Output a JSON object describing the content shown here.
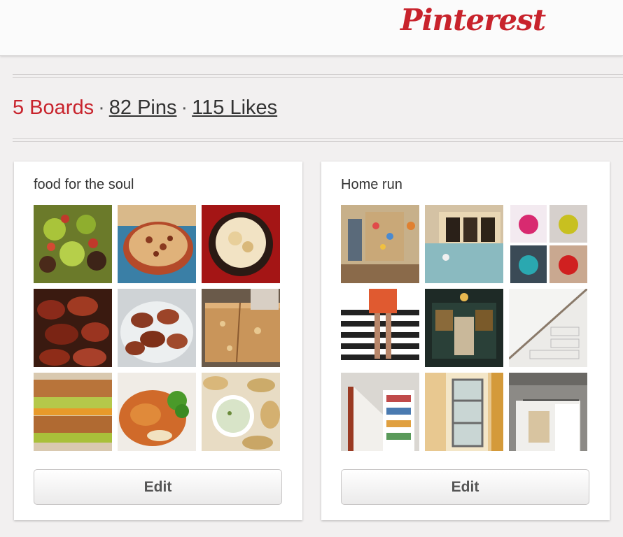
{
  "app": {
    "logo_text": "Pinterest",
    "brand_color": "#c8232c"
  },
  "profile_stats": {
    "boards": "5 Boards",
    "pins": "82 Pins",
    "likes": "115 Likes",
    "separator": "·"
  },
  "boards": [
    {
      "title": "food for the soul",
      "edit_label": "Edit",
      "thumbnails": [
        "avocado-salad",
        "pasta-pot",
        "baked-soup-bowl",
        "bacon-wrapped-bites",
        "bacon-wrapped-bites-plate",
        "crumb-bars",
        "grilled-cheese-avocado",
        "chicken-salad",
        "dumplings-with-dip"
      ]
    },
    {
      "title": "Home run",
      "edit_label": "Edit",
      "thumbnails": [
        "kids-room-corkboard",
        "drawer-organizer",
        "chandeliers-collage",
        "zebra-stairs",
        "library-room",
        "under-stair-drawers",
        "stair-bookshelf",
        "sliding-glass-door",
        "barn-door"
      ]
    }
  ]
}
